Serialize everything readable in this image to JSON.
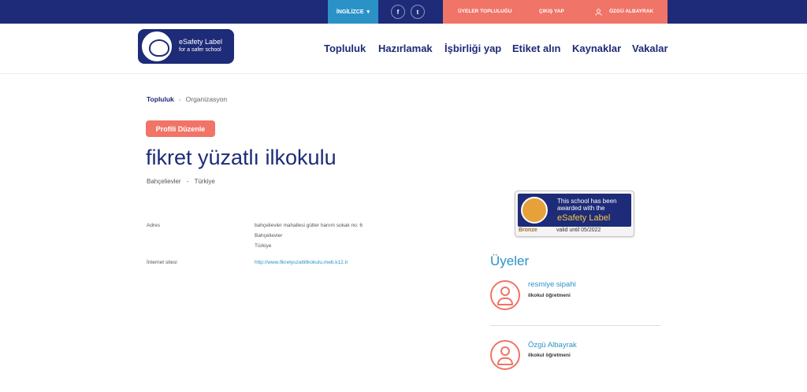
{
  "topbar": {
    "language": "İNGİLİZCE",
    "social": {
      "facebook": "f",
      "twitter": "t"
    },
    "community_link": "ÜYELER TOPLULUĞU",
    "logout_link": "ÇIKIŞ YAP",
    "user_link": "ÖZGÜ ALBAYRAK"
  },
  "logo": {
    "line1": "eSafety Label",
    "line2": "for a safer school"
  },
  "nav": [
    "Topluluk",
    "Hazırlamak",
    "İşbirliği yap",
    "Etiket alın",
    "Kaynaklar",
    "Vakalar"
  ],
  "breadcrumb": {
    "parent": "Topluluk",
    "separator": "›",
    "current": "Organizasyon"
  },
  "edit_button": "Profili Düzenle",
  "school": {
    "name": "fikret yüzatlı ilkokulu",
    "city": "Bahçelievler",
    "separator": "-",
    "country": "Türkiye"
  },
  "details": {
    "address_label": "Adres",
    "address_line1": "bahçelievler mahallesi gülter hanım sokak no: 6",
    "address_line2": "Bahçelievler",
    "address_line3": "Türkiye",
    "website_label": "İnternet sitesi",
    "website": "http://www.fikretyuzatliilkokulu.meb.k12.tr"
  },
  "badge": {
    "line1": "This school has been",
    "line2": "awarded with the",
    "line3": "eSafety Label",
    "level": "Bronze",
    "valid": "valid until 05/2022"
  },
  "members": {
    "title": "Üyeler",
    "list": [
      {
        "name": "resmiye sipahi",
        "role": "ilkokul öğretmeni"
      },
      {
        "name": "Özgü Albayrak",
        "role": "ilkokul öğretmeni"
      }
    ]
  },
  "colors": {
    "navy": "#1d2b78",
    "blue": "#2b92c7",
    "coral": "#f07467"
  }
}
